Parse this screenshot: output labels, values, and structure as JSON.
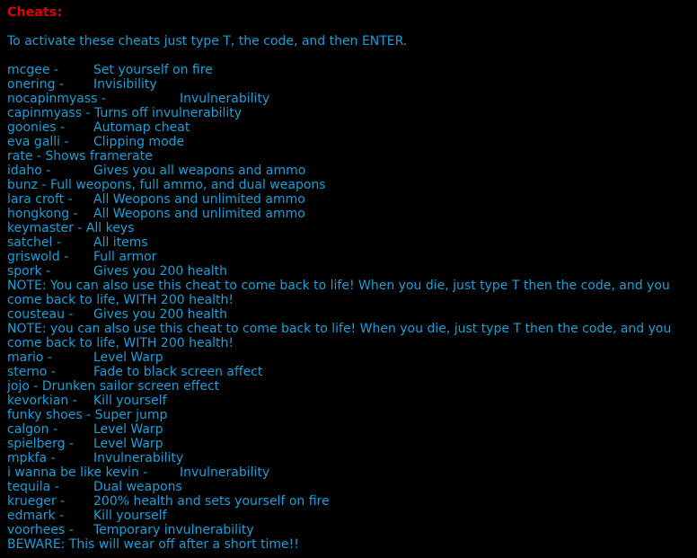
{
  "page": {
    "background_color": "#000000",
    "heading_color": "#e80000",
    "body_text_color": "#1a9fd9"
  },
  "heading": "Cheats:",
  "intro": "To activate these cheats just type T, the code, and then ENTER.",
  "cheats": [
    {
      "code": "mcgee - ",
      "tab": "\t",
      "desc": "Set yourself on fire"
    },
    {
      "code": "onering - ",
      "tab": "\t",
      "desc": "Invisibility"
    },
    {
      "code": "nocapinmyass - ",
      "tab": "\t",
      "desc": "Invulnerability"
    },
    {
      "code": "capinmyass - ",
      "tab": "",
      "desc": "Turns off invulnerability"
    },
    {
      "code": "goonies - ",
      "tab": "\t",
      "desc": "Automap cheat"
    },
    {
      "code": "eva galli - ",
      "tab": "\t",
      "desc": "Clipping mode"
    },
    {
      "code": "rate - ",
      "tab": "",
      "desc": "Shows framerate"
    },
    {
      "code": "idaho - ",
      "tab": "\t",
      "desc": "Gives you all weapons and ammo"
    },
    {
      "code": "bunz - ",
      "tab": "",
      "desc": "Full weopons, full ammo, and dual weapons"
    },
    {
      "code": "lara croft - ",
      "tab": "\t",
      "desc": "All Weopons and unlimited ammo"
    },
    {
      "code": "hongkong - ",
      "tab": "\t",
      "desc": "All Weopons and unlimited ammo"
    },
    {
      "code": "keymaster - ",
      "tab": "",
      "desc": "All keys"
    },
    {
      "code": "satchel - ",
      "tab": "\t",
      "desc": "All items"
    },
    {
      "code": "griswold - ",
      "tab": "\t",
      "desc": "Full armor"
    },
    {
      "code": "spork - ",
      "tab": "\t",
      "desc": "Gives you 200 health"
    }
  ],
  "note_one": "NOTE: You can also use this cheat to come back to life! When you die, just type T then the code, and you come back to life, WITH 200 health!",
  "cousteau": {
    "code": "cousteau - ",
    "tab": "\t",
    "desc": "Gives you 200 health"
  },
  "note_two": "NOTE: you can also use this cheat to come back to life! When you die, just type T then the code, and you come back to life, WITH 200 health!",
  "cheats_two": [
    {
      "code": "mario - ",
      "tab": "\t",
      "desc": "Level Warp"
    },
    {
      "code": "sterno - ",
      "tab": "\t",
      "desc": "Fade to black screen affect"
    },
    {
      "code": "jojo - ",
      "tab": "",
      "desc": "Drunken sailor screen effect"
    },
    {
      "code": "kevorkian - ",
      "tab": "\t",
      "desc": "Kill yourself"
    },
    {
      "code": "funky shoes - ",
      "tab": "",
      "desc": "Super jump"
    },
    {
      "code": "calgon - ",
      "tab": "\t",
      "desc": "Level Warp"
    },
    {
      "code": "spielberg - ",
      "tab": "\t",
      "desc": "Level Warp"
    },
    {
      "code": "mpkfa - ",
      "tab": "\t",
      "desc": "Invulnerability"
    },
    {
      "code": "i wanna be like kevin - ",
      "tab": "\t",
      "desc": "Invulnerability"
    },
    {
      "code": "tequila - ",
      "tab": "\t",
      "desc": "Dual weapons"
    },
    {
      "code": "krueger - ",
      "tab": "\t",
      "desc": "200% health and sets yourself on fire"
    },
    {
      "code": "edmark - ",
      "tab": "\t",
      "desc": "Kill yourself"
    },
    {
      "code": "voorhees - ",
      "tab": "\t",
      "desc": "Temporary invulnerability"
    }
  ],
  "beware": "BEWARE: This will wear off after a short time!!"
}
